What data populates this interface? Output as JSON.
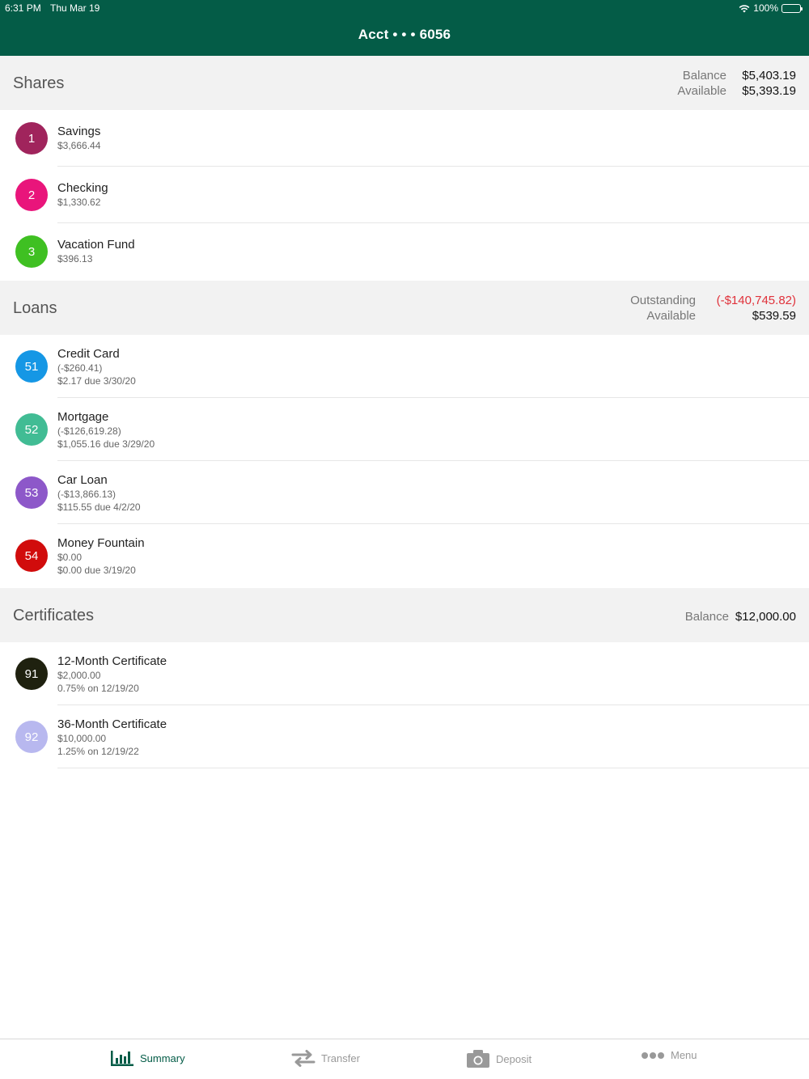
{
  "status_bar": {
    "time": "6:31 PM",
    "date": "Thu Mar 19",
    "battery": "100%"
  },
  "header": {
    "title": "Acct • • • 6056"
  },
  "shares": {
    "title": "Shares",
    "balance_label": "Balance",
    "balance_value": "$5,403.19",
    "available_label": "Available",
    "available_value": "$5,393.19",
    "items": [
      {
        "badge": "1",
        "color": "#a0245c",
        "name": "Savings",
        "line1": "$3,666.44"
      },
      {
        "badge": "2",
        "color": "#e9157b",
        "name": "Checking",
        "line1": "$1,330.62"
      },
      {
        "badge": "3",
        "color": "#3fc022",
        "name": "Vacation Fund",
        "line1": "$396.13"
      }
    ]
  },
  "loans": {
    "title": "Loans",
    "outstanding_label": "Outstanding",
    "outstanding_value": "(-$140,745.82)",
    "available_label": "Available",
    "available_value": "$539.59",
    "items": [
      {
        "badge": "51",
        "color": "#1597e5",
        "name": "Credit Card",
        "line1": "(-$260.41)",
        "line2": "$2.17 due 3/30/20"
      },
      {
        "badge": "52",
        "color": "#41bc94",
        "name": "Mortgage",
        "line1": "(-$126,619.28)",
        "line2": "$1,055.16 due 3/29/20"
      },
      {
        "badge": "53",
        "color": "#8d58c9",
        "name": "Car Loan",
        "line1": "(-$13,866.13)",
        "line2": "$115.55 due 4/2/20"
      },
      {
        "badge": "54",
        "color": "#d10c0c",
        "name": "Money Fountain",
        "line1": "$0.00",
        "line2": "$0.00 due 3/19/20"
      }
    ]
  },
  "certificates": {
    "title": "Certificates",
    "balance_label": "Balance",
    "balance_value": "$12,000.00",
    "items": [
      {
        "badge": "91",
        "color": "#1f210f",
        "name": "12-Month Certificate",
        "line1": "$2,000.00",
        "line2": "0.75% on 12/19/20"
      },
      {
        "badge": "92",
        "color": "#b8b8ef",
        "name": "36-Month Certificate",
        "line1": "$10,000.00",
        "line2": "1.25% on 12/19/22"
      }
    ]
  },
  "tabbar": {
    "summary": "Summary",
    "transfer": "Transfer",
    "deposit": "Deposit",
    "menu": "Menu"
  },
  "colors": {
    "brand": "#045c47",
    "negative": "#e0323b"
  }
}
